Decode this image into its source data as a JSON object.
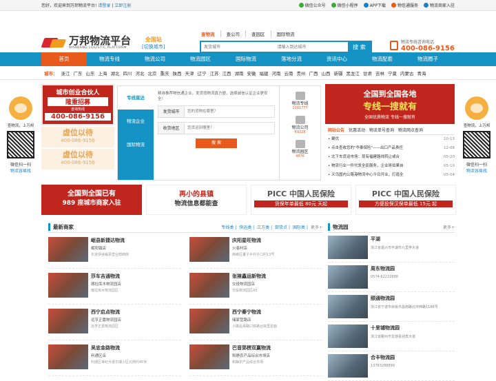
{
  "topbar": {
    "welcome": "您好，欢迎来到万邦物流平台!",
    "login": "请登录",
    "register": "立即注册",
    "links": [
      {
        "label": "微信公众号",
        "color": "#3bab3b"
      },
      {
        "label": "微信小程序",
        "color": "#3bab3b"
      },
      {
        "label": "APP下载",
        "color": "#1a7fc4"
      },
      {
        "label": "物信通服务",
        "color": "#e85a1b"
      },
      {
        "label": "物流商家入驻",
        "color": "#1a7fc4"
      }
    ]
  },
  "header": {
    "logo_name": "万邦物流平台",
    "logo_sub": "WANBANG LOGISTIC PLATFORM",
    "city_name": "全国站",
    "city_switch": "[切换城市]",
    "search_tabs": [
      "查物流",
      "查公司",
      "查园区",
      "国际物流"
    ],
    "search_from_placeholder": "发货城市",
    "search_to_placeholder": "请输入到达城市",
    "search_button": "搜 索",
    "hotline_label": "物流专线咨询电话",
    "hotline_number": "400-086-9156"
  },
  "nav": [
    "首页",
    "物流专线",
    "物流公司",
    "物流园区",
    "国际物流",
    "落地分流",
    "资讯中心",
    "物流配套",
    "物流圈子"
  ],
  "citybar": {
    "label": "城市：",
    "cities": [
      "浙江",
      "广东",
      "山东",
      "上海",
      "湖北",
      "四川",
      "河北",
      "北京",
      "重庆",
      "陕西",
      "天津",
      "辽宁",
      "江苏",
      "江西",
      "湖南",
      "安徽",
      "福建",
      "河南",
      "云南",
      "贵州",
      "广西",
      "山西",
      "新疆",
      "黑龙江",
      "甘肃",
      "吉林",
      "宁夏",
      "内蒙古",
      "青海"
    ]
  },
  "side": {
    "top_label": "查物流，上万邦",
    "scan": "微信扫一扫",
    "slogan": "物流容易找"
  },
  "ads_left": {
    "ad1_title": "城市创业合伙人",
    "ad1_sub": "隆重招募",
    "ad1_hot": "咨询热线",
    "ad1_phone": "400-086-9156",
    "placeholder_text": "虚位以待",
    "placeholder_phone": "400-086-9156"
  },
  "service": {
    "tabs": [
      "专线直达",
      "物流企业",
      "国际物流"
    ],
    "intro": "精准推荐物信通企业，发货找物流真方便，选择诚信认证企业更安全！",
    "from_label": "发货城市",
    "from_placeholder": "您的货物在哪里？",
    "to_label": "收货地区",
    "to_placeholder": "您货运到哪里？",
    "button": "搜 索"
  },
  "stats": [
    {
      "name": "物流专线",
      "value": "1091777"
    },
    {
      "name": "物流公司",
      "value": "69328"
    },
    {
      "name": "物流园区",
      "value": "4876"
    }
  ],
  "banner_right": {
    "line1": "全国到全国各地",
    "line2": "专线一搜就有",
    "line3": "全国优质物流 专线一搜就有"
  },
  "news": {
    "tabs": [
      "网站公告",
      "优惠活动",
      "物流单号查询",
      "物流网点查询"
    ],
    "items": [
      {
        "title": "聚优",
        "date": "10-13"
      },
      {
        "title": "点击查收您的\"华泰保险\"——出口产品责任",
        "date": "12-08"
      },
      {
        "title": "北下车货运市场：现有福建路线转让或合",
        "date": "05-20"
      },
      {
        "title": "物流行业一件代发全民服务，企业将如果自",
        "date": "05-10"
      },
      {
        "title": "义乌国内公路港物流中心今日开业，打造全",
        "date": "05-04"
      }
    ]
  },
  "adrow": [
    {
      "type": "r",
      "line1": "全国到全国已有",
      "line2": "989 座城市商家入驻"
    },
    {
      "type": "w",
      "line1": "再小的县镇",
      "line2": "物流信息都能查"
    },
    {
      "type": "p",
      "line1": "PICC 中国人民保险",
      "line2": "货保年单最低 80元 天起"
    },
    {
      "type": "p",
      "line1": "PICC 中国人民保险",
      "line2": "方便投保汉保单最低 15元 起"
    }
  ],
  "merchants": {
    "title": "最新商家",
    "links": [
      "专线类",
      "快运类",
      "三方类",
      "卸货点",
      "国际类"
    ],
    "more": "更多+",
    "items": [
      {
        "name": "岷县新捷达物流",
        "sub": "岷阳镇店",
        "addr": "东京快递岷县营业部西侧"
      },
      {
        "name": "庆阳星旺物流",
        "sub": "火巷村店",
        "addr": "西峰区董子乡村子口村13号"
      },
      {
        "name": "莎车吉通物流",
        "sub": "喀拉库木物流园店",
        "addr": "喀拉库木物流园区"
      },
      {
        "name": "张掖鑫运新物流",
        "sub": "交投物流园店",
        "addr": "交投物流园区A5"
      },
      {
        "name": "西宁启点物流",
        "sub": "远亨正嘉物流园店",
        "addr": "远亨正嘉物流园区"
      },
      {
        "name": "西宁秦宁物流",
        "sub": "储家营路店",
        "addr": "小康品易路口铁路台库里星面"
      },
      {
        "name": "吴忠金路物流",
        "sub": "利通区店",
        "addr": "利通区世纪大道华瑞小区北侧约40米"
      },
      {
        "name": "巴音郭楞双赢物流",
        "sub": "和静农产品综合市场店",
        "addr": "和静农产品综合市场"
      }
    ]
  },
  "parks": {
    "title": "物流园",
    "more": "更多+",
    "items": [
      {
        "name": "平湖",
        "addr": "浙江省嘉兴市平湖市九里亭大道"
      },
      {
        "name": "周东物流园",
        "addr": "0574-62222888"
      },
      {
        "name": "颐通物流园",
        "addr": "浙江省宁波市余姚市昌南路北环西路1188号"
      },
      {
        "name": "十里铺物流园",
        "addr": "浙江省衢州市龙游县迎宾大道"
      },
      {
        "name": "合丰物流园",
        "addr": "13783288899"
      }
    ]
  }
}
